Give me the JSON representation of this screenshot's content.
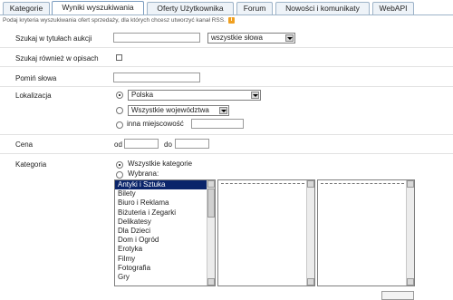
{
  "tabs": [
    {
      "label": "Kategorie",
      "active": false
    },
    {
      "label": "Wyniki wyszukiwania",
      "active": true
    },
    {
      "label": "Oferty Użytkownika",
      "active": false
    },
    {
      "label": "Forum",
      "active": false
    },
    {
      "label": "Nowości i komunikaty",
      "active": false
    },
    {
      "label": "WebAPI",
      "active": false
    }
  ],
  "info_text": "Podaj kryteria wyszukiwania ofert sprzedaży, dla których chcesz utworzyć kanał RSS.",
  "form": {
    "search_titles_label": "Szukaj w tytułach aukcji",
    "search_titles_value": "",
    "words_mode": "wszystkie słowa",
    "search_desc_label": "Szukaj również w opisach",
    "skip_words_label": "Pomiń słowa",
    "skip_words_value": "",
    "location_label": "Lokalizacja",
    "country": "Polska",
    "voivodeship": "Wszystkie województwa",
    "other_city_label": "inna miejscowość",
    "other_city_value": "",
    "price_label": "Cena",
    "price_from_label": "od",
    "price_to_label": "do",
    "category_label": "Kategoria",
    "all_categories_label": "Wszystkie kategorie",
    "selected_label": "Wybrana:",
    "categories": [
      "Antyki i Sztuka",
      "Bilety",
      "Biuro i Reklama",
      "Biżuteria i Zegarki",
      "Delikatesy",
      "Dla Dzieci",
      "Dom i Ogród",
      "Erotyka",
      "Filmy",
      "Fotografia",
      "Gry"
    ],
    "selected_category": "Antyki i Sztuka"
  },
  "colors": {
    "tab_border": "#9db3c8",
    "selection": "#0a246a",
    "info_icon": "#f0a020"
  }
}
